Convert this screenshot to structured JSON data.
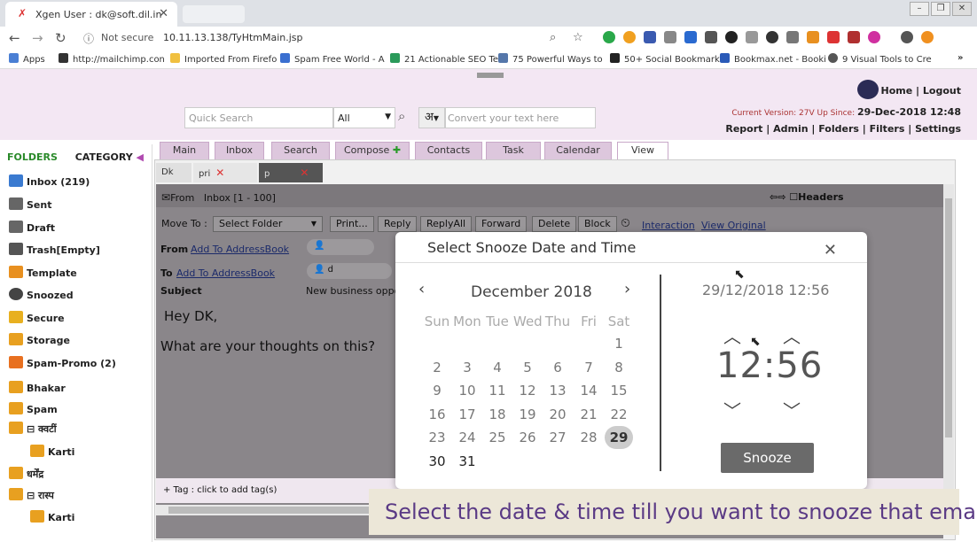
{
  "browser": {
    "tab_title": "Xgen User : dk@soft.dil.in",
    "not_secure": "Not secure",
    "url": "10.11.13.138/TyHtmMain.jsp"
  },
  "bookmarks": [
    {
      "label": "Apps",
      "color": "#4a7fd4"
    },
    {
      "label": "http://mailchimp.con",
      "color": "#333333"
    },
    {
      "label": "Imported From Firefo",
      "color": "#f0c040"
    },
    {
      "label": "Spam Free World - A",
      "color": "#3a6fd0"
    },
    {
      "label": "21 Actionable SEO Te",
      "color": "#2a9a5a"
    },
    {
      "label": "75 Powerful Ways to",
      "color": "#5577aa"
    },
    {
      "label": "50+ Social Bookmark",
      "color": "#222222"
    },
    {
      "label": "Bookmax.net - Booki",
      "color": "#2a5ab8"
    },
    {
      "label": "9 Visual Tools to Cre",
      "color": "#555555"
    }
  ],
  "header": {
    "quick_search_placeholder": "Quick Search",
    "search_scope": "All",
    "lang_button": "अ",
    "convert_placeholder": "Convert your text here",
    "home": "Home",
    "logout": "Logout",
    "version_label": "Current Version: 27V Up Since:",
    "version_date": "29-Dec-2018 12:48",
    "links": [
      "Report",
      "Admin",
      "Folders",
      "Filters",
      "Settings"
    ]
  },
  "sidebar": {
    "folders_label": "FOLDERS",
    "category_label": "CATEGORY",
    "items": [
      {
        "label": "Inbox (219)",
        "color": "#3a7ad0"
      },
      {
        "label": "Sent",
        "color": "#666666"
      },
      {
        "label": "Draft",
        "color": "#666666"
      },
      {
        "label": "Trash[Empty]",
        "color": "#555555"
      },
      {
        "label": "Template",
        "color": "#e89020"
      },
      {
        "label": "Snoozed",
        "color": "#444444"
      },
      {
        "label": "Secure",
        "color": "#e8b020"
      },
      {
        "label": "Storage",
        "color": "#e8a020"
      },
      {
        "label": "Spam-Promo (2)",
        "color": "#e87020"
      },
      {
        "label": "Bhakar",
        "color": "#e8a020"
      },
      {
        "label": "Spam",
        "color": "#e8a020"
      },
      {
        "label": "⊟ क्वटीं",
        "color": "#e8a020"
      },
      {
        "label": "Karti",
        "color": "#e8a020"
      },
      {
        "label": "धर्मेंद्र",
        "color": "#e8a020"
      },
      {
        "label": "⊟ रास्प",
        "color": "#e8a020"
      },
      {
        "label": "Karti",
        "color": "#e8a020"
      }
    ]
  },
  "main_tabs": [
    "Main",
    "Inbox",
    "Search",
    "Compose",
    "Contacts",
    "Task",
    "Calendar",
    "View"
  ],
  "sub_tabs": [
    "Dk",
    "pri",
    "p"
  ],
  "email": {
    "from_header": "From",
    "folder_info": "Inbox [1 - 100]",
    "headers_label": "Headers",
    "move_to": "Move To :",
    "select_folder": "Select Folder",
    "buttons": [
      "Print...",
      "Reply",
      "ReplyAll",
      "Forward",
      "Delete",
      "Block"
    ],
    "interaction_link": "Interaction",
    "view_original_link": "View Original",
    "from_label": "From",
    "to_label": "To",
    "add_to_addressbook": "Add To AddressBook",
    "subject_label": "Subject",
    "subject_value": "New business oppo",
    "body_greeting": "Hey DK,",
    "body_line": "What are your thoughts on this?",
    "tag_hint": "+ Tag : click to add tag(s)"
  },
  "snooze_modal": {
    "title": "Select Snooze Date and Time",
    "month": "December 2018",
    "weekdays": [
      "Sun",
      "Mon",
      "Tue",
      "Wed",
      "Thu",
      "Fri",
      "Sat"
    ],
    "weeks": [
      [
        "",
        "",
        "",
        "",
        "",
        "",
        "1"
      ],
      [
        "2",
        "3",
        "4",
        "5",
        "6",
        "7",
        "8"
      ],
      [
        "9",
        "10",
        "11",
        "12",
        "13",
        "14",
        "15"
      ],
      [
        "16",
        "17",
        "18",
        "19",
        "20",
        "21",
        "22"
      ],
      [
        "23",
        "24",
        "25",
        "26",
        "27",
        "28",
        "29"
      ],
      [
        "30",
        "31",
        "",
        "",
        "",
        "",
        ""
      ]
    ],
    "selected_day": "29",
    "datetime_display": "29/12/2018 12:56",
    "hour": "12",
    "minute": "56",
    "snooze_button": "Snooze"
  },
  "caption": "Select the date & time till you want to snooze that email"
}
